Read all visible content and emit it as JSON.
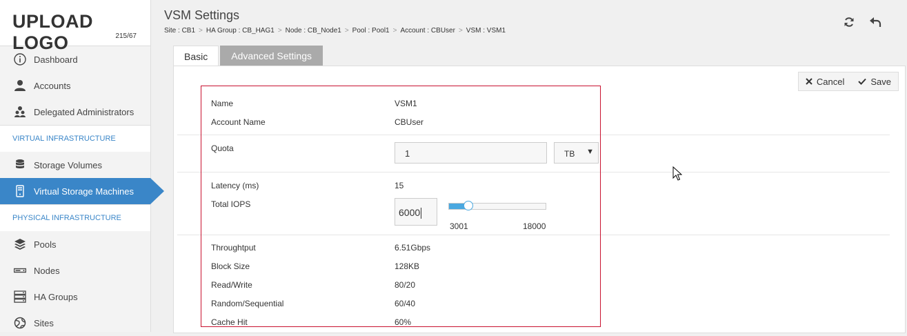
{
  "logo": {
    "text": "UPLOAD LOGO",
    "sub": "215/67"
  },
  "sidebar": {
    "items": [
      {
        "label": "Dashboard"
      },
      {
        "label": "Accounts"
      },
      {
        "label": "Delegated Administrators"
      }
    ],
    "section1": "VIRTUAL INFRASTRUCTURE",
    "items2": [
      {
        "label": "Storage Volumes"
      },
      {
        "label": "Virtual Storage Machines"
      }
    ],
    "section2": "PHYSICAL INFRASTRUCTURE",
    "items3": [
      {
        "label": "Pools"
      },
      {
        "label": "Nodes"
      },
      {
        "label": "HA Groups"
      },
      {
        "label": "Sites"
      }
    ]
  },
  "header": {
    "title": "VSM Settings",
    "breadcrumb": [
      "Site : CB1",
      "HA Group : CB_HAG1",
      "Node : CB_Node1",
      "Pool : Pool1",
      "Account : CBUser",
      "VSM : VSM1"
    ]
  },
  "tabs": {
    "basic": "Basic",
    "advanced": "Advanced Settings"
  },
  "actions": {
    "cancel": "Cancel",
    "save": "Save"
  },
  "form": {
    "name_label": "Name",
    "name_value": "VSM1",
    "account_label": "Account Name",
    "account_value": "CBUser",
    "quota_label": "Quota",
    "quota_value": "1",
    "quota_unit": "TB",
    "latency_label": "Latency (ms)",
    "latency_value": "15",
    "iops_label": "Total IOPS",
    "iops_value": "6000",
    "iops_min": "3001",
    "iops_max": "18000",
    "iops_slider_fraction": 0.2,
    "throughput_label": "Throughtput",
    "throughput_value": "6.51Gbps",
    "block_label": "Block Size",
    "block_value": "128KB",
    "rw_label": "Read/Write",
    "rw_value": "80/20",
    "rs_label": "Random/Sequential",
    "rs_value": "60/40",
    "cache_label": "Cache Hit",
    "cache_value": "60%"
  },
  "colors": {
    "accent": "#3a86c8",
    "highlight_border": "#c8102e",
    "slider": "#4aa8e0"
  }
}
